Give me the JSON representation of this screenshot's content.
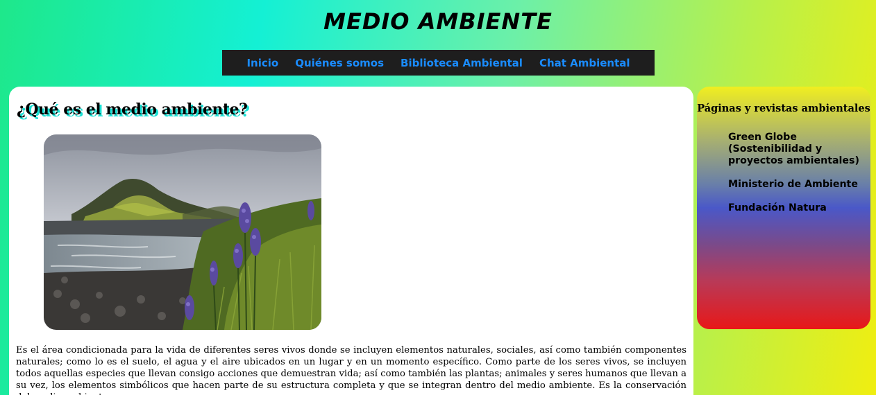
{
  "header": {
    "title": "MEDIO AMBIENTE"
  },
  "nav": {
    "items": [
      {
        "label": "Inicio"
      },
      {
        "label": "Quiénes somos"
      },
      {
        "label": "Biblioteca Ambiental"
      },
      {
        "label": "Chat Ambiental"
      }
    ]
  },
  "article": {
    "heading": "¿Qué es el medio ambiente?",
    "body": "Es el área condicionada para la vida de diferentes seres vivos donde se incluyen elementos naturales, sociales, así como también componentes naturales; como lo es el suelo, el agua y el aire ubicados en un lugar y en un momento específico. Como parte de los seres vivos, se incluyen todos aquellas especies que llevan consigo acciones que demuestran vida; así como también las plantas; animales y seres humanos que llevan a su vez, los elementos simbólicos que hacen parte de su estructura completa y que se integran dentro del medio ambiente. Es la conservación del medio ambiente,"
  },
  "sidebar": {
    "heading": "Páginas y revistas ambientales",
    "links": [
      {
        "label": "Green Globe (Sostenibilidad y proyectos ambientales)"
      },
      {
        "label": "Ministerio de Ambiente"
      },
      {
        "label": "Fundación Natura"
      }
    ]
  },
  "colors": {
    "nav_link": "#1a8cff",
    "nav_bg": "#1e1e1e",
    "heading_shadow": "#19e0d4"
  }
}
